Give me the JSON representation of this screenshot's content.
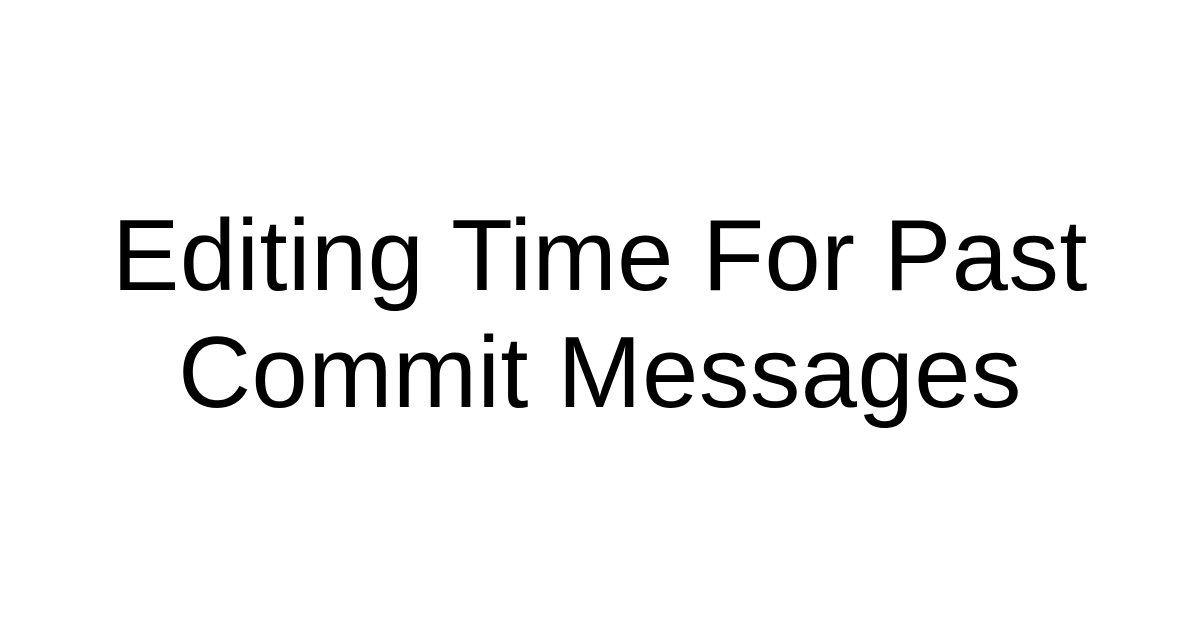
{
  "title": {
    "line1": "Editing Time For Past",
    "line2": "Commit Messages"
  },
  "colors": {
    "background": "#ffffff",
    "text": "#000000"
  }
}
